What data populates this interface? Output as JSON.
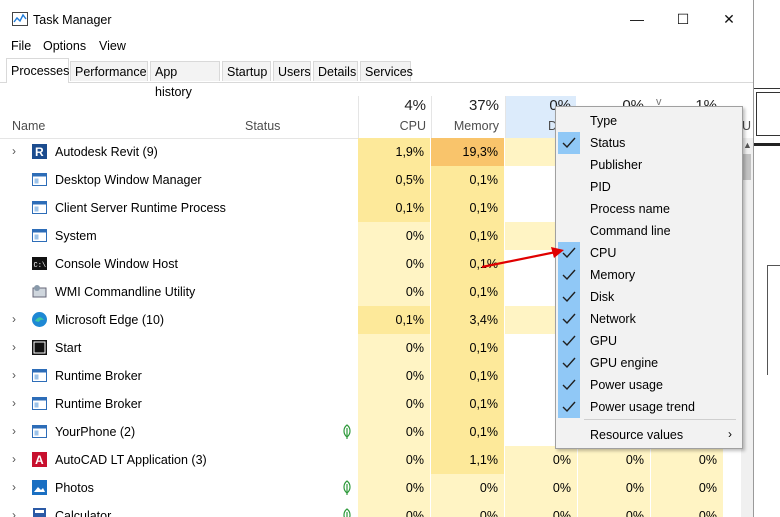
{
  "window": {
    "title": "Task Manager",
    "controls": {
      "minimize": "—",
      "maximize": "☐",
      "close": "✕"
    }
  },
  "menubar": [
    "File",
    "Options",
    "View"
  ],
  "tabs": [
    "Processes",
    "Performance",
    "App history",
    "Startup",
    "Users",
    "Details",
    "Services"
  ],
  "active_tab": "Processes",
  "columns": {
    "name": "Name",
    "status": "Status",
    "cpu": {
      "pct": "4%",
      "label": "CPU"
    },
    "memory": {
      "pct": "37%",
      "label": "Memory"
    },
    "disk": {
      "pct": "0%",
      "label": "D"
    },
    "network": {
      "pct": "0%"
    },
    "gpu": {
      "pct": "1%"
    },
    "gpu_engine_label": "U"
  },
  "rows": [
    {
      "name": "Autodesk Revit (9)",
      "icon": "revit-icon",
      "expand": true,
      "leaf": false,
      "cpu": "1,9%",
      "memory": "19,3%",
      "disk": "0,",
      "network": "",
      "gpu": ""
    },
    {
      "name": "Desktop Window Manager",
      "icon": "window-icon",
      "expand": false,
      "leaf": false,
      "cpu": "0,5%",
      "memory": "0,1%",
      "disk": "",
      "network": "",
      "gpu": ""
    },
    {
      "name": "Client Server Runtime Process",
      "icon": "window-icon",
      "expand": false,
      "leaf": false,
      "cpu": "0,1%",
      "memory": "0,1%",
      "disk": "",
      "network": "",
      "gpu": ""
    },
    {
      "name": "System",
      "icon": "window-icon",
      "expand": false,
      "leaf": false,
      "cpu": "0%",
      "memory": "0,1%",
      "disk": "0,",
      "network": "",
      "gpu": ""
    },
    {
      "name": "Console Window Host",
      "icon": "console-icon",
      "expand": false,
      "leaf": false,
      "cpu": "0%",
      "memory": "0,1%",
      "disk": "",
      "network": "",
      "gpu": ""
    },
    {
      "name": "WMI Commandline Utility",
      "icon": "wmi-icon",
      "expand": false,
      "leaf": false,
      "cpu": "0%",
      "memory": "0,1%",
      "disk": "",
      "network": "",
      "gpu": ""
    },
    {
      "name": "Microsoft Edge (10)",
      "icon": "edge-icon",
      "expand": true,
      "leaf": false,
      "cpu": "0,1%",
      "memory": "3,4%",
      "disk": "0,",
      "network": "",
      "gpu": ""
    },
    {
      "name": "Start",
      "icon": "start-icon",
      "expand": true,
      "leaf": false,
      "cpu": "0%",
      "memory": "0,1%",
      "disk": "",
      "network": "",
      "gpu": ""
    },
    {
      "name": "Runtime Broker",
      "icon": "window-icon",
      "expand": true,
      "leaf": false,
      "cpu": "0%",
      "memory": "0,1%",
      "disk": "",
      "network": "",
      "gpu": ""
    },
    {
      "name": "Runtime Broker",
      "icon": "window-icon",
      "expand": true,
      "leaf": false,
      "cpu": "0%",
      "memory": "0,1%",
      "disk": "",
      "network": "",
      "gpu": ""
    },
    {
      "name": "YourPhone (2)",
      "icon": "window-icon",
      "expand": true,
      "leaf": true,
      "cpu": "0%",
      "memory": "0,1%",
      "disk": "",
      "network": "",
      "gpu": ""
    },
    {
      "name": "AutoCAD LT Application (3)",
      "icon": "autocad-icon",
      "expand": true,
      "leaf": false,
      "cpu": "0%",
      "memory": "1,1%",
      "disk": "0%",
      "network": "0%",
      "gpu": "0%"
    },
    {
      "name": "Photos",
      "icon": "photos-icon",
      "expand": true,
      "leaf": true,
      "cpu": "0%",
      "memory": "0%",
      "disk": "0%",
      "network": "0%",
      "gpu": "0%"
    },
    {
      "name": "Calculator",
      "icon": "calculator-icon",
      "expand": true,
      "leaf": true,
      "cpu": "0%",
      "memory": "0%",
      "disk": "0%",
      "network": "0%",
      "gpu": "0%"
    }
  ],
  "context_menu": {
    "items": [
      {
        "label": "Type",
        "checked": false
      },
      {
        "label": "Status",
        "checked": true
      },
      {
        "label": "Publisher",
        "checked": false
      },
      {
        "label": "PID",
        "checked": false
      },
      {
        "label": "Process name",
        "checked": false
      },
      {
        "label": "Command line",
        "checked": false
      },
      {
        "label": "CPU",
        "checked": true
      },
      {
        "label": "Memory",
        "checked": true
      },
      {
        "label": "Disk",
        "checked": true
      },
      {
        "label": "Network",
        "checked": true
      },
      {
        "label": "GPU",
        "checked": true
      },
      {
        "label": "GPU engine",
        "checked": true
      },
      {
        "label": "Power usage",
        "checked": true
      },
      {
        "label": "Power usage trend",
        "checked": true
      }
    ],
    "footer": {
      "label": "Resource values",
      "submenu_glyph": "›"
    }
  },
  "colors": {
    "heat_light": "#fff4c4",
    "heat_mid": "#fde99a",
    "heat_strong": "#f9c46b",
    "check_bg": "#90c8f6",
    "arrow": "#e00000"
  }
}
